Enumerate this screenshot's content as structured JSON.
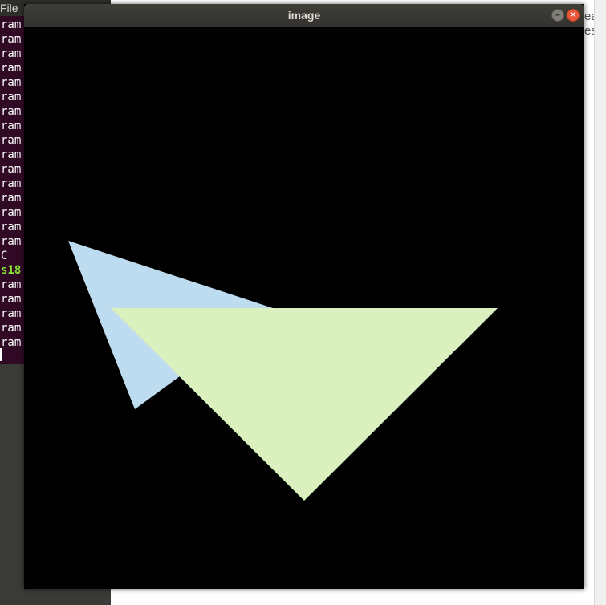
{
  "terminal": {
    "menu_first": "File",
    "lines": [
      "ram",
      "ram",
      "ram",
      "ram",
      "ram",
      "ram",
      "ram",
      "ram",
      "ram",
      "ram",
      "ram",
      "ram",
      "ram",
      "ram",
      "ram",
      "ram",
      "C",
      "s18",
      "ram",
      "ram",
      "ram",
      "ram",
      "ram"
    ]
  },
  "editor": {
    "line1": "eatu",
    "line2": "ests"
  },
  "window": {
    "title": "image",
    "minimize_glyph": "–",
    "close_glyph": "✕"
  },
  "canvas": {
    "background": "#000000",
    "shapes": [
      {
        "name": "blue-triangle",
        "color": "#bddcf0"
      },
      {
        "name": "green-triangle",
        "color": "#dbf0bf"
      }
    ]
  }
}
